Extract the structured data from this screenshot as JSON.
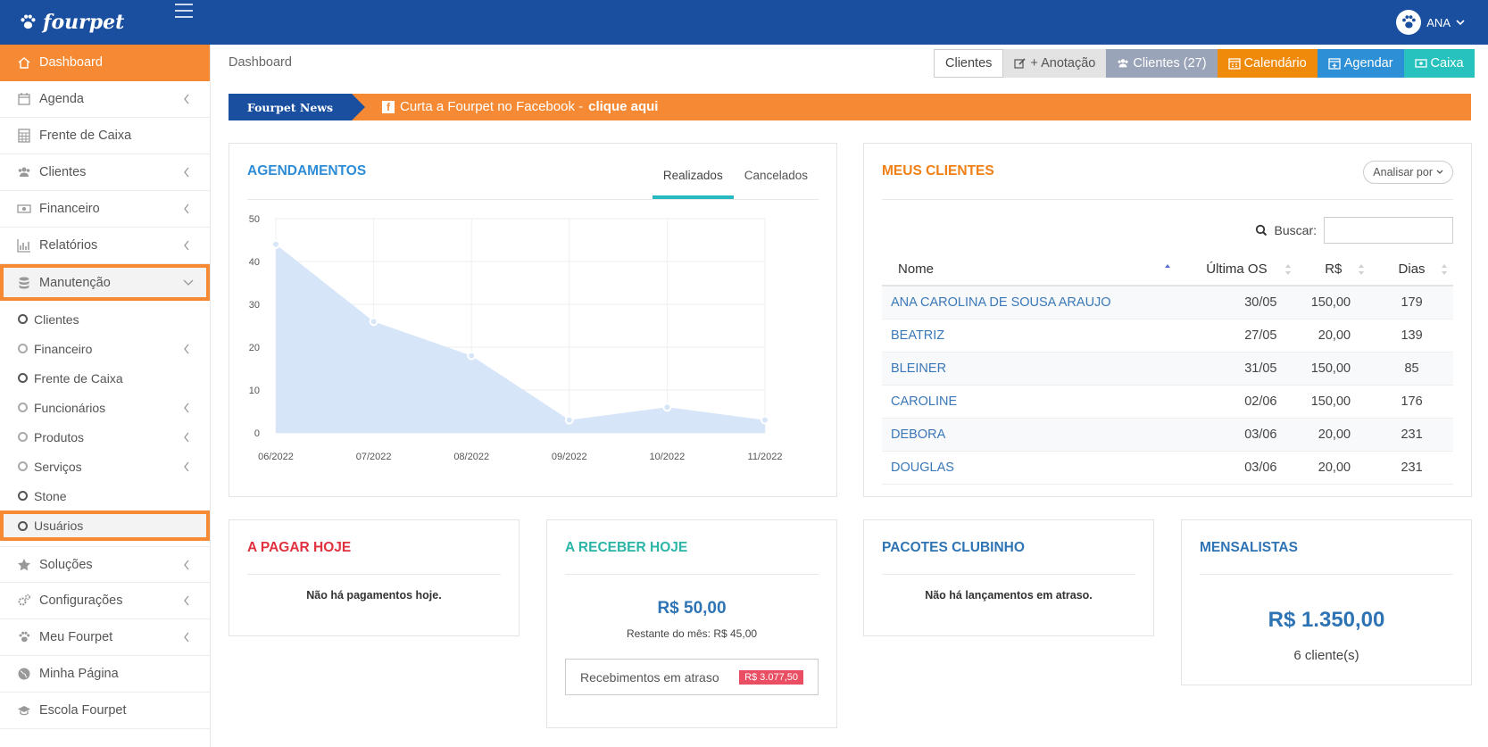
{
  "brand": {
    "name": "fourpet"
  },
  "user": {
    "name": "ANA"
  },
  "sidebar": {
    "items": [
      {
        "label": "Dashboard"
      },
      {
        "label": "Agenda"
      },
      {
        "label": "Frente de Caixa"
      },
      {
        "label": "Clientes"
      },
      {
        "label": "Financeiro"
      },
      {
        "label": "Relatórios"
      },
      {
        "label": "Manutenção"
      }
    ],
    "subitems": [
      {
        "label": "Clientes"
      },
      {
        "label": "Financeiro"
      },
      {
        "label": "Frente de Caixa"
      },
      {
        "label": "Funcionários"
      },
      {
        "label": "Produtos"
      },
      {
        "label": "Serviços"
      },
      {
        "label": "Stone"
      },
      {
        "label": "Usuários"
      }
    ],
    "items2": [
      {
        "label": "Soluções"
      },
      {
        "label": "Configurações"
      },
      {
        "label": "Meu Fourpet"
      },
      {
        "label": "Minha Página"
      },
      {
        "label": "Escola Fourpet"
      }
    ]
  },
  "header": {
    "breadcrumb": "Dashboard",
    "buttons": {
      "clientes": "Clientes",
      "anotacao": "+ Anotação",
      "clientes_count": "Clientes (27)",
      "calendario": "Calendário",
      "agendar": "Agendar",
      "caixa": "Caixa"
    }
  },
  "news": {
    "tag": "Fourpet News",
    "text": "Curta a Fourpet no Facebook - ",
    "link": "clique aqui"
  },
  "agendamentos": {
    "title": "AGENDAMENTOS",
    "tab_on": "Realizados",
    "tab_off": "Cancelados"
  },
  "chart_data": {
    "type": "area",
    "title": "",
    "x": [
      "06/2022",
      "07/2022",
      "08/2022",
      "09/2022",
      "10/2022",
      "11/2022"
    ],
    "series": [
      {
        "values": [
          44,
          26,
          18,
          3,
          6,
          3
        ]
      }
    ],
    "ylim": [
      0,
      50
    ],
    "yticks": [
      "0",
      "10",
      "20",
      "30",
      "40",
      "50"
    ],
    "grid": true,
    "fill_color": "#d6e6f8"
  },
  "clientes_panel": {
    "title": "MEUS CLIENTES",
    "analisar": "Analisar por",
    "buscar": "Buscar:",
    "columns": [
      "Nome",
      "Última OS",
      "R$",
      "Dias"
    ],
    "rows": [
      [
        "ANA CAROLINA DE SOUSA ARAUJO",
        "30/05",
        "150,00",
        "179"
      ],
      [
        "BEATRIZ",
        "27/05",
        "20,00",
        "139"
      ],
      [
        "BLEINER",
        "31/05",
        "150,00",
        "85"
      ],
      [
        "CAROLINE",
        "02/06",
        "150,00",
        "176"
      ],
      [
        "DEBORA",
        "03/06",
        "20,00",
        "231"
      ],
      [
        "DOUGLAS",
        "03/06",
        "20,00",
        "231"
      ]
    ]
  },
  "pagar": {
    "title": "A PAGAR HOJE",
    "msg": "Não há pagamentos hoje."
  },
  "receber": {
    "title": "A RECEBER HOJE",
    "amount": "R$ 50,00",
    "restante": "Restante do mês: R$ 45,00",
    "late_label": "Recebimentos em atraso",
    "late_value": "R$ 3.077,50"
  },
  "pacotes": {
    "title": "PACOTES CLUBINHO",
    "msg": "Não há lançamentos em atraso."
  },
  "mensalistas": {
    "title": "MENSALISTAS",
    "amount": "R$ 1.350,00",
    "count": "6 cliente(s)"
  },
  "colors": {
    "topbar": "#1a4fa0",
    "accent": "#f68a34",
    "teal": "#27b8c0",
    "red": "#e0313f",
    "green": "#2bb5a6"
  }
}
